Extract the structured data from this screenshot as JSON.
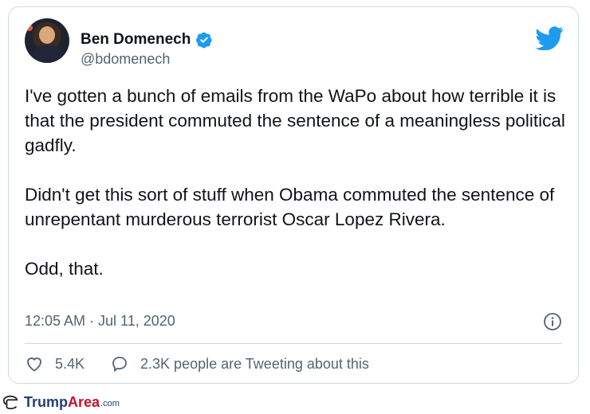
{
  "tweet": {
    "author_name": "Ben Domenech",
    "handle": "@bdomenech",
    "paragraphs": [
      "I've gotten a bunch of emails from the WaPo about how terrible it is that the president commuted the sentence of a meaningless political gadfly.",
      "Didn't get this sort of stuff when Obama commuted the sentence of unrepentant murderous terrorist Oscar Lopez Rivera.",
      "Odd, that."
    ],
    "timestamp": "12:05 AM · Jul 11, 2020",
    "likes": "5.4K",
    "tweeting_about": "2.3K people are Tweeting about this"
  },
  "icons": {
    "platform": "twitter-bird-icon",
    "verified": "verified-badge-icon",
    "info": "info-icon",
    "like": "heart-icon",
    "reply": "speech-bubble-icon"
  },
  "watermark": {
    "brand_part1": "Trump",
    "brand_part2": "Area",
    "suffix": ".com"
  },
  "colors": {
    "brand_blue": "#1d9bf0",
    "text": "#0f1419",
    "secondary": "#536471",
    "border": "#cfd9de"
  }
}
